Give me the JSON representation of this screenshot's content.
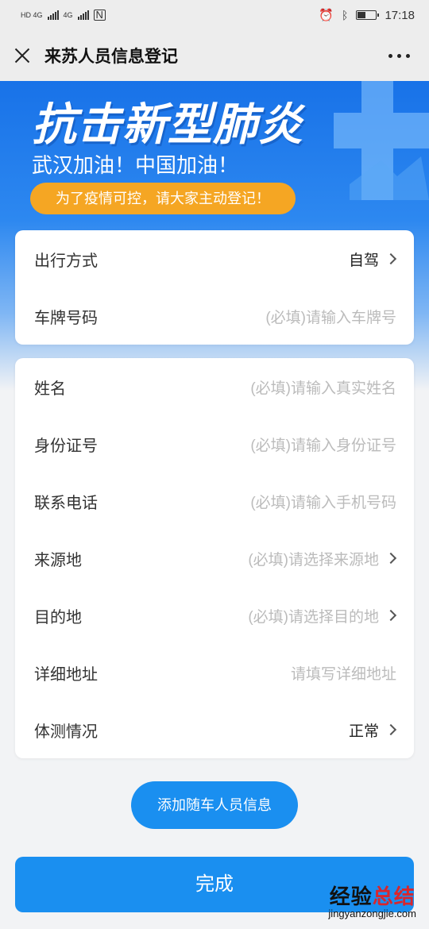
{
  "status_bar": {
    "network_left": "HD 4G",
    "network_right": "4G",
    "time": "17:18",
    "battery_level": 0.45
  },
  "title_bar": {
    "title": "来苏人员信息登记"
  },
  "banner": {
    "title": "抗击新型肺炎",
    "subtitle": "武汉加油！中国加油！",
    "pill_text": "为了疫情可控，请大家主动登记！"
  },
  "travel_card": {
    "rows": [
      {
        "label": "出行方式",
        "value": "自驾"
      },
      {
        "label": "车牌号码",
        "placeholder": "(必填)请输入车牌号"
      }
    ]
  },
  "person_card": {
    "rows": [
      {
        "label": "姓名",
        "placeholder": "(必填)请输入真实姓名"
      },
      {
        "label": "身份证号",
        "placeholder": "(必填)请输入身份证号"
      },
      {
        "label": "联系电话",
        "placeholder": "(必填)请输入手机号码"
      },
      {
        "label": "来源地",
        "placeholder": "(必填)请选择来源地"
      },
      {
        "label": "目的地",
        "placeholder": "(必填)请选择目的地"
      },
      {
        "label": "详细地址",
        "placeholder": "请填写详细地址"
      },
      {
        "label": "体测情况",
        "value": "正常"
      }
    ]
  },
  "actions": {
    "add_companion_label": "添加随车人员信息",
    "done_label": "完成"
  },
  "watermark": {
    "text_prefix": "经验",
    "text_accent": "总结",
    "url": "jingyanzongjie.com"
  },
  "colors": {
    "accent_blue": "#1a8ff0",
    "pill_orange": "#f5a623",
    "banner_blue": "#1872e8"
  }
}
